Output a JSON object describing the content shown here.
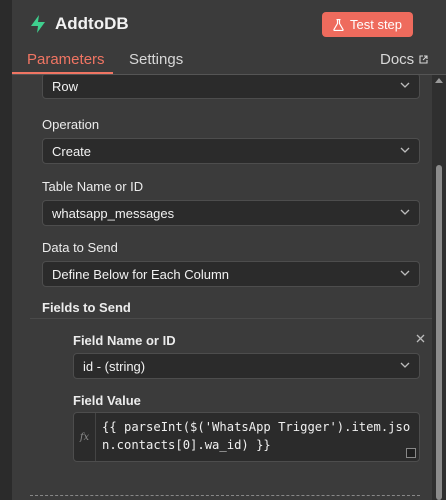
{
  "header": {
    "title": "AddtoDB",
    "test_step_label": "Test step"
  },
  "tabs": {
    "parameters": "Parameters",
    "settings": "Settings",
    "docs": "Docs"
  },
  "form": {
    "row_select_value": "Row",
    "operation_label": "Operation",
    "operation_value": "Create",
    "table_label": "Table Name or ID",
    "table_value": "whatsapp_messages",
    "data_to_send_label": "Data to Send",
    "data_to_send_value": "Define Below for Each Column",
    "fields_to_send_label": "Fields to Send",
    "field_name_label": "Field Name or ID",
    "field_name_value": "id - (string)",
    "field_value_label": "Field Value",
    "field_value_expression": "{{ parseInt($('WhatsApp Trigger').item.json.contacts[0].wa_id) }}",
    "fx_label": "fx"
  },
  "colors": {
    "accent": "#f07563",
    "button": "#ee6b5d",
    "node_icon": "#3fcf8e"
  }
}
